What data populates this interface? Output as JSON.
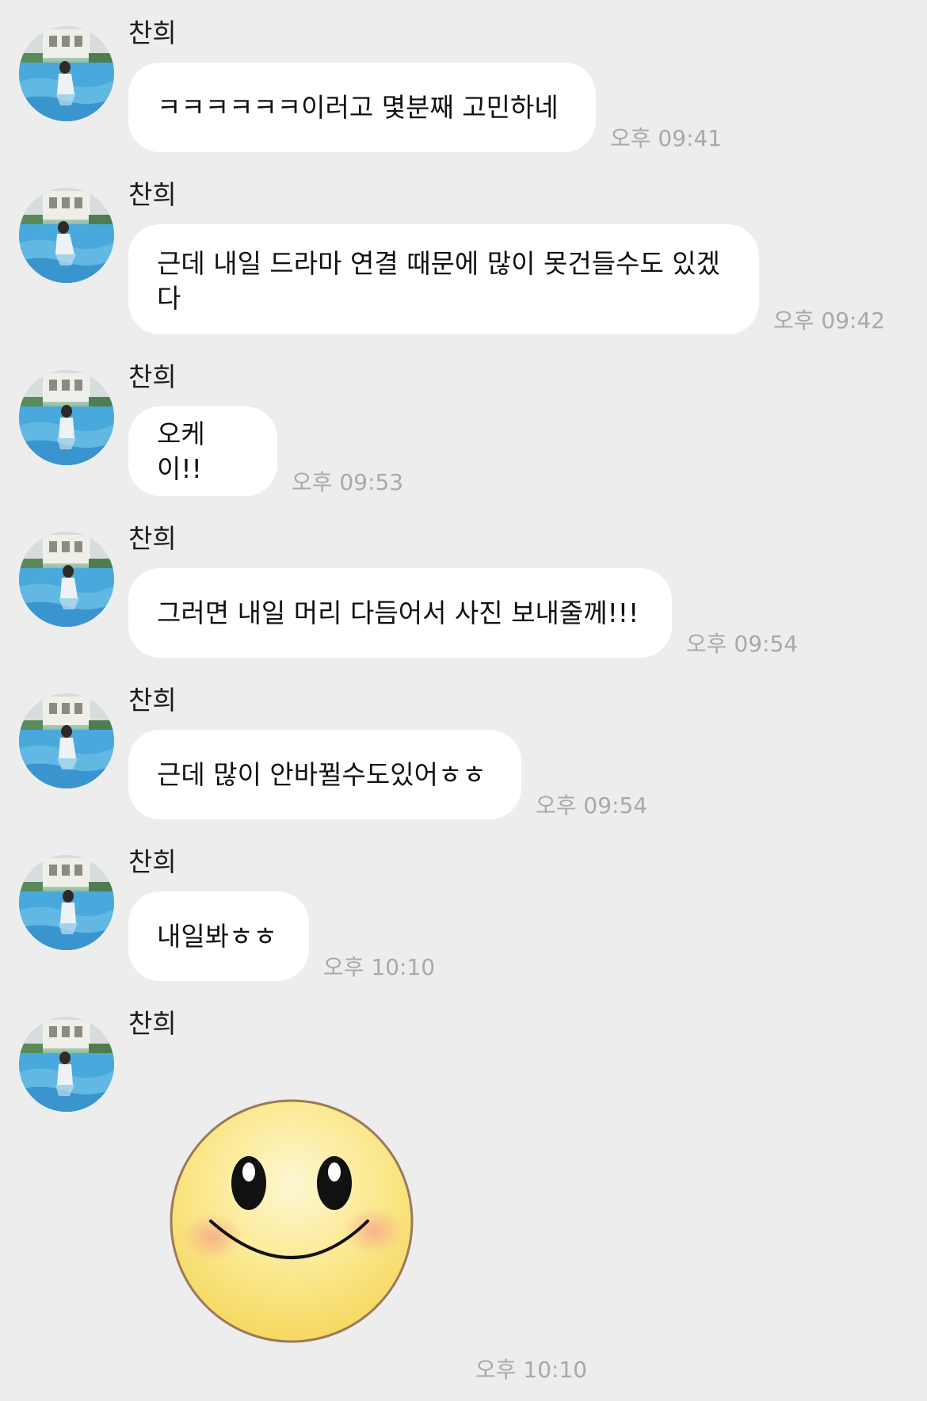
{
  "messages": [
    {
      "sender": "찬희",
      "text": "ㅋㅋㅋㅋㅋㅋ이러고 몇분째 고민하네",
      "time": "오후 09:41"
    },
    {
      "sender": "찬희",
      "text_line1": "근데 내일 드라마 연결 때문에 많이 못건들수도 있겠",
      "text_line2": "다",
      "time": "오후 09:42"
    },
    {
      "sender": "찬희",
      "text": "오케이!!",
      "time": "오후 09:53"
    },
    {
      "sender": "찬희",
      "text": "그러면 내일 머리 다듬어서 사진 보내줄께!!!",
      "time": "오후 09:54"
    },
    {
      "sender": "찬희",
      "text": "근데 많이 안바뀔수도있어ㅎㅎ",
      "time": "오후 09:54"
    },
    {
      "sender": "찬희",
      "text": "내일봐ㅎㅎ",
      "time": "오후 10:10"
    },
    {
      "sender": "찬희",
      "emoticon": "smiley-face-emoticon",
      "time": "오후 10:10"
    }
  ],
  "colors": {
    "background": "#ededed",
    "bubble": "#ffffff",
    "text": "#111111",
    "timestamp": "#a9a9a9"
  }
}
